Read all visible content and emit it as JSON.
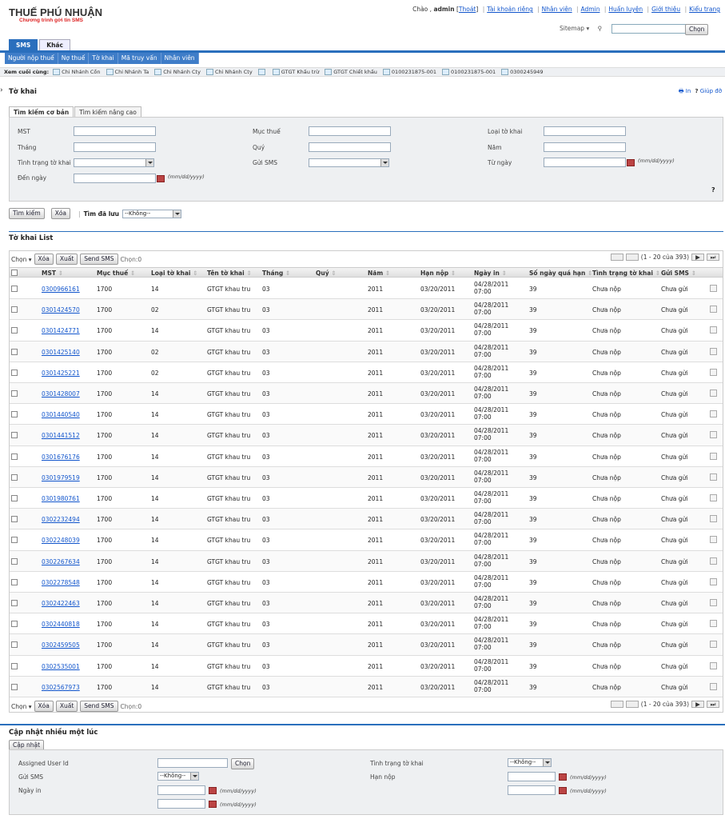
{
  "header": {
    "logo_title": "THUẾ PHÚ NHUẬN",
    "logo_subtitle": "Chương trình gởi tin SMS",
    "greeting_prefix": "Chào ,",
    "user": "admin",
    "logout": "Thoát",
    "links": [
      "Tài khoản riêng",
      "Nhân viên",
      "Admin",
      "Huấn luyện",
      "Giới thiệu",
      "Kiểu trang"
    ],
    "sitemap": "Sitemap",
    "search_button": "Chọn"
  },
  "top_tabs": [
    "SMS",
    "Khác"
  ],
  "menu": [
    "Người nộp thuế",
    "Nợ thuế",
    "Tờ khai",
    "Mã truy vấn",
    "Nhân viên"
  ],
  "recent": {
    "label": "Xem cuối cùng:",
    "items": [
      "Chi Nhánh Cồn",
      "Chi Nhánh Ta",
      "Chi Nhánh Cty",
      "Chi Nhánh Cty",
      "",
      "GTGT Khấu trừ",
      "GTGT Chiết khấu",
      "0100231875-001",
      "0100231875-001",
      "0300245949"
    ]
  },
  "section": {
    "title": "Tờ khai",
    "print": "In",
    "help": "Giúp đỡ"
  },
  "search_tabs": [
    "Tìm kiếm cơ bản",
    "Tìm kiếm nâng cao"
  ],
  "search_form": {
    "mst": "MST",
    "muc_thue": "Mục thuế",
    "loai_to_khai": "Loại tờ khai",
    "thang": "Tháng",
    "quy": "Quý",
    "nam": "Năm",
    "tinh_trang": "Tình trạng tờ khai",
    "gui_sms": "Gửi SMS",
    "tu_ngay": "Từ ngày",
    "den_ngay": "Đến ngày",
    "date_hint": "(mm/dd/yyyy)",
    "help_mark": "?"
  },
  "search_actions": {
    "search": "Tìm kiếm",
    "clear": "Xóa",
    "saved_label": "Tìm đã lưu",
    "saved_value": "--Không--"
  },
  "list": {
    "title": "Tờ khai List",
    "choose": "Chọn",
    "delete": "Xóa",
    "export": "Xuất",
    "send": "Send SMS",
    "selected": "Chọn:0",
    "range": "(1 - 20 của 393)"
  },
  "columns": [
    "MST",
    "Mục thuế",
    "Loại tờ khai",
    "Tên tờ khai",
    "Tháng",
    "Quý",
    "Năm",
    "Hạn nộp",
    "Ngày in",
    "Số ngày quá hạn",
    "Tình trạng tờ khai",
    "Gửi SMS"
  ],
  "rows": [
    [
      "0300966161",
      "1700",
      "14",
      "GTGT khau tru",
      "03",
      "",
      "2011",
      "03/20/2011",
      "04/28/2011",
      "07:00",
      "39",
      "Chưa nộp",
      "Chưa gửi"
    ],
    [
      "0301424570",
      "1700",
      "02",
      "GTGT khau tru",
      "03",
      "",
      "2011",
      "03/20/2011",
      "04/28/2011",
      "07:00",
      "39",
      "Chưa nộp",
      "Chưa gửi"
    ],
    [
      "0301424771",
      "1700",
      "14",
      "GTGT khau tru",
      "03",
      "",
      "2011",
      "03/20/2011",
      "04/28/2011",
      "07:00",
      "39",
      "Chưa nộp",
      "Chưa gửi"
    ],
    [
      "0301425140",
      "1700",
      "02",
      "GTGT khau tru",
      "03",
      "",
      "2011",
      "03/20/2011",
      "04/28/2011",
      "07:00",
      "39",
      "Chưa nộp",
      "Chưa gửi"
    ],
    [
      "0301425221",
      "1700",
      "02",
      "GTGT khau tru",
      "03",
      "",
      "2011",
      "03/20/2011",
      "04/28/2011",
      "07:00",
      "39",
      "Chưa nộp",
      "Chưa gửi"
    ],
    [
      "0301428007",
      "1700",
      "14",
      "GTGT khau tru",
      "03",
      "",
      "2011",
      "03/20/2011",
      "04/28/2011",
      "07:00",
      "39",
      "Chưa nộp",
      "Chưa gửi"
    ],
    [
      "0301440540",
      "1700",
      "14",
      "GTGT khau tru",
      "03",
      "",
      "2011",
      "03/20/2011",
      "04/28/2011",
      "07:00",
      "39",
      "Chưa nộp",
      "Chưa gửi"
    ],
    [
      "0301441512",
      "1700",
      "14",
      "GTGT khau tru",
      "03",
      "",
      "2011",
      "03/20/2011",
      "04/28/2011",
      "07:00",
      "39",
      "Chưa nộp",
      "Chưa gửi"
    ],
    [
      "0301676176",
      "1700",
      "14",
      "GTGT khau tru",
      "03",
      "",
      "2011",
      "03/20/2011",
      "04/28/2011",
      "07:00",
      "39",
      "Chưa nộp",
      "Chưa gửi"
    ],
    [
      "0301979519",
      "1700",
      "14",
      "GTGT khau tru",
      "03",
      "",
      "2011",
      "03/20/2011",
      "04/28/2011",
      "07:00",
      "39",
      "Chưa nộp",
      "Chưa gửi"
    ],
    [
      "0301980761",
      "1700",
      "14",
      "GTGT khau tru",
      "03",
      "",
      "2011",
      "03/20/2011",
      "04/28/2011",
      "07:00",
      "39",
      "Chưa nộp",
      "Chưa gửi"
    ],
    [
      "0302232494",
      "1700",
      "14",
      "GTGT khau tru",
      "03",
      "",
      "2011",
      "03/20/2011",
      "04/28/2011",
      "07:00",
      "39",
      "Chưa nộp",
      "Chưa gửi"
    ],
    [
      "0302248039",
      "1700",
      "14",
      "GTGT khau tru",
      "03",
      "",
      "2011",
      "03/20/2011",
      "04/28/2011",
      "07:00",
      "39",
      "Chưa nộp",
      "Chưa gửi"
    ],
    [
      "0302267634",
      "1700",
      "14",
      "GTGT khau tru",
      "03",
      "",
      "2011",
      "03/20/2011",
      "04/28/2011",
      "07:00",
      "39",
      "Chưa nộp",
      "Chưa gửi"
    ],
    [
      "0302278548",
      "1700",
      "14",
      "GTGT khau tru",
      "03",
      "",
      "2011",
      "03/20/2011",
      "04/28/2011",
      "07:00",
      "39",
      "Chưa nộp",
      "Chưa gửi"
    ],
    [
      "0302422463",
      "1700",
      "14",
      "GTGT khau tru",
      "03",
      "",
      "2011",
      "03/20/2011",
      "04/28/2011",
      "07:00",
      "39",
      "Chưa nộp",
      "Chưa gửi"
    ],
    [
      "0302440818",
      "1700",
      "14",
      "GTGT khau tru",
      "03",
      "",
      "2011",
      "03/20/2011",
      "04/28/2011",
      "07:00",
      "39",
      "Chưa nộp",
      "Chưa gửi"
    ],
    [
      "0302459505",
      "1700",
      "14",
      "GTGT khau tru",
      "03",
      "",
      "2011",
      "03/20/2011",
      "04/28/2011",
      "07:00",
      "39",
      "Chưa nộp",
      "Chưa gửi"
    ],
    [
      "0302535001",
      "1700",
      "14",
      "GTGT khau tru",
      "03",
      "",
      "2011",
      "03/20/2011",
      "04/28/2011",
      "07:00",
      "39",
      "Chưa nộp",
      "Chưa gửi"
    ],
    [
      "0302567973",
      "1700",
      "14",
      "GTGT khau tru",
      "03",
      "",
      "2011",
      "03/20/2011",
      "04/28/2011",
      "07:00",
      "39",
      "Chưa nộp",
      "Chưa gửi"
    ]
  ],
  "mass_update": {
    "title": "Cập nhật nhiều một lúc",
    "button": "Cập nhật",
    "assigned": "Assigned User Id",
    "choose": "Chọn",
    "gui_sms": "Gửi SMS",
    "gui_sms_value": "--Không--",
    "ngay_in": "Ngày in",
    "tinh_trang": "Tình trạng tờ khai",
    "tinh_trang_value": "--Không--",
    "han_nop": "Hạn nộp",
    "date_hint": "(mm/dd/yyyy)"
  }
}
